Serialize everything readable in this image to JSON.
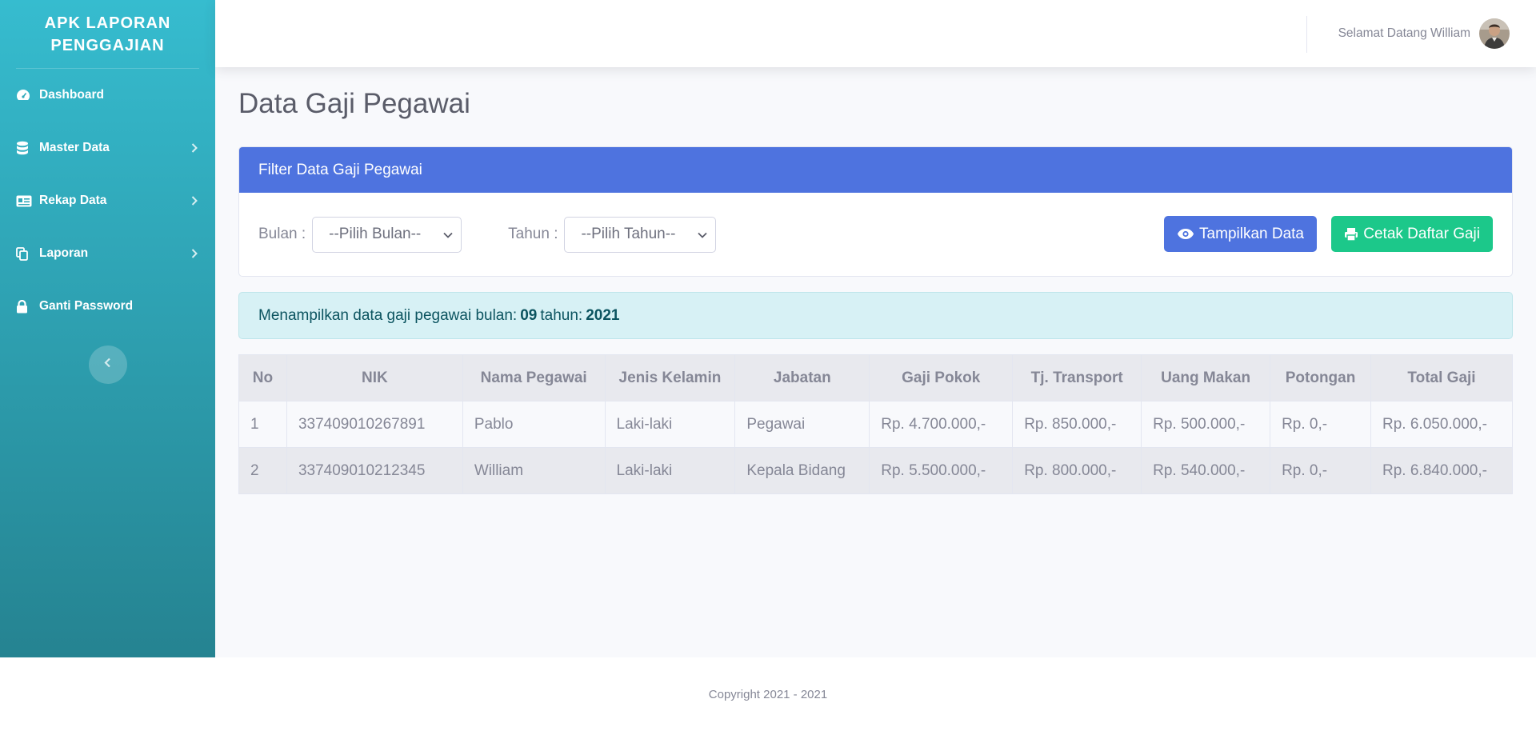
{
  "app": {
    "brand": "APK LAPORAN PENGGAJIAN"
  },
  "sidebar": {
    "items": [
      {
        "label": "Dashboard",
        "icon": "tachometer-icon"
      },
      {
        "label": "Master Data",
        "icon": "database-icon"
      },
      {
        "label": "Rekap Data",
        "icon": "id-card-icon"
      },
      {
        "label": "Laporan",
        "icon": "copy-icon"
      },
      {
        "label": "Ganti Password",
        "icon": "lock-icon"
      }
    ],
    "toggle_icon": "chevron-left-icon"
  },
  "topbar": {
    "user_greeting": "Selamat Datang William"
  },
  "main": {
    "title": "Data Gaji Pegawai",
    "filter": {
      "header": "Filter Data Gaji Pegawai",
      "bulan_label": "Bulan :",
      "bulan_value": "--Pilih Bulan--",
      "tahun_label": "Tahun :",
      "tahun_value": "--Pilih Tahun--",
      "show_button": "Tampilkan Data",
      "print_button": "Cetak Daftar Gaji"
    },
    "alert": {
      "prefix": "Menampilkan data gaji pegawai bulan:",
      "month": "09",
      "mid": "tahun:",
      "year": "2021"
    },
    "table": {
      "headers": [
        "No",
        "NIK",
        "Nama Pegawai",
        "Jenis Kelamin",
        "Jabatan",
        "Gaji Pokok",
        "Tj. Transport",
        "Uang Makan",
        "Potongan",
        "Total Gaji"
      ],
      "rows": [
        [
          "1",
          "337409010267891",
          "Pablo",
          "Laki-laki",
          "Pegawai",
          "Rp. 4.700.000,-",
          "Rp. 850.000,-",
          "Rp. 500.000,-",
          "Rp. 0,-",
          "Rp. 6.050.000,-"
        ],
        [
          "2",
          "337409010212345",
          "William",
          "Laki-laki",
          "Kepala Bidang",
          "Rp. 5.500.000,-",
          "Rp. 800.000,-",
          "Rp. 540.000,-",
          "Rp. 0,-",
          "Rp. 6.840.000,-"
        ]
      ]
    }
  },
  "footer": {
    "text": "Copyright 2021 - 2021"
  },
  "colors": {
    "primary": "#4e73df",
    "success": "#1cc88a",
    "sidebar_top": "#36bccf",
    "sidebar_bottom": "#258391",
    "alert_bg": "#d7f1f5"
  }
}
